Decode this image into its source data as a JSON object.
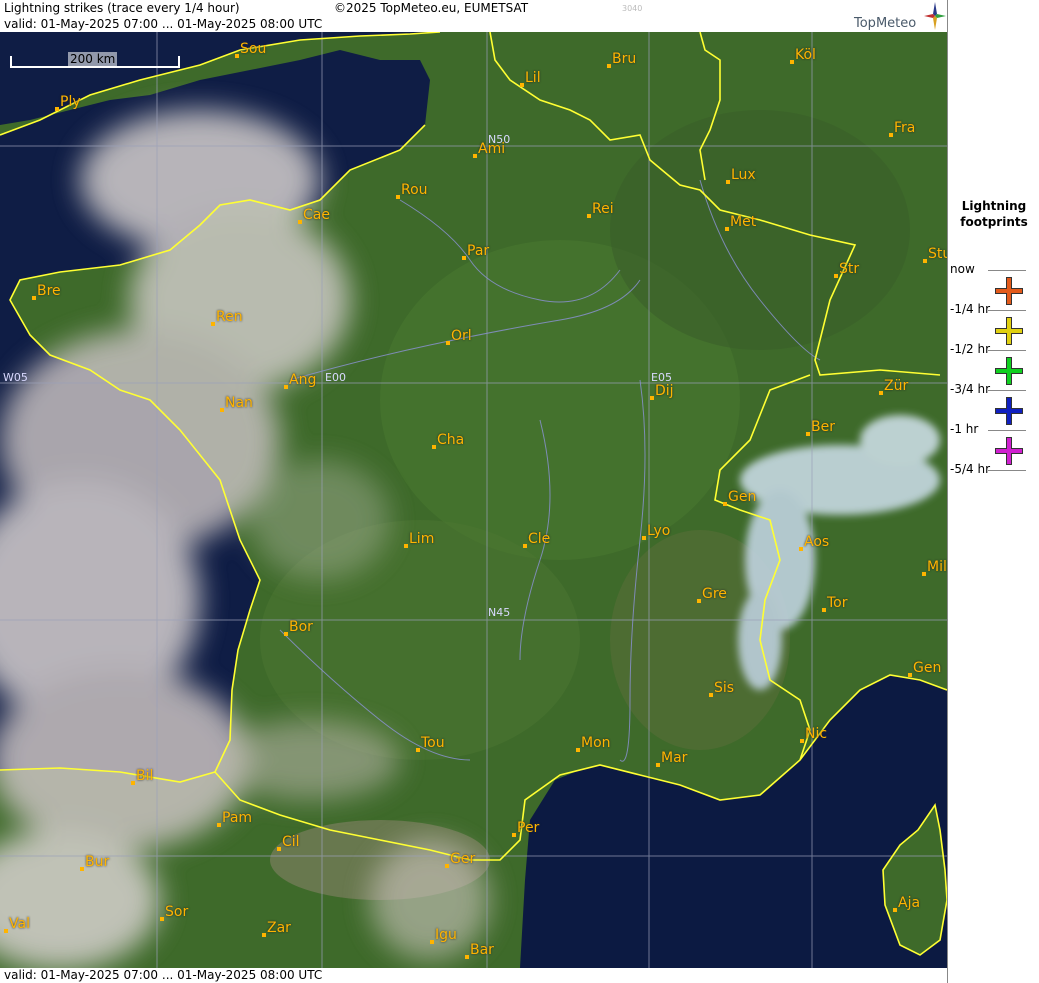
{
  "header": {
    "title": "Lightning strikes (trace every 1/4 hour)",
    "copyright": "©2025 TopMeteo.eu, EUMETSAT",
    "code": "3040",
    "valid": "valid:  01-May-2025 07:00 ... 01-May-2025 08:00 UTC",
    "brand": "TopMeteo"
  },
  "footer": {
    "valid": "valid:  01-May-2025 07:00 ... 01-May-2025 08:00 UTC"
  },
  "scale_label": "200 km",
  "grid_labels": [
    "N50",
    "E00",
    "E05",
    "W05",
    "N45"
  ],
  "cities": [
    "Sou",
    "Ply",
    "Lil",
    "Bru",
    "Köl",
    "Ami",
    "Fra",
    "Rou",
    "Lux",
    "Cae",
    "Rei",
    "Met",
    "Par",
    "Stu",
    "Str",
    "Bre",
    "Ren",
    "Orl",
    "Ang",
    "Zür",
    "Dij",
    "Nan",
    "Ber",
    "Cha",
    "Gen",
    "Lim",
    "Cle",
    "Lyo",
    "Aos",
    "Mil",
    "Gre",
    "Bor",
    "Tor",
    "Gen",
    "Sis",
    "Tou",
    "Mon",
    "Mar",
    "Nic",
    "Bil",
    "Pam",
    "Per",
    "Cil",
    "Ger",
    "Bur",
    "Sor",
    "Aja",
    "Val",
    "Zar",
    "Igu",
    "Bar"
  ],
  "legend": {
    "title_line1": "Lightning",
    "title_line2": "footprints",
    "rows": [
      {
        "label": "now",
        "color": "#e35a1a"
      },
      {
        "label": "-1/4 hr",
        "color": "#e0d010"
      },
      {
        "label": "-1/2 hr",
        "color": "#10d020"
      },
      {
        "label": "-3/4 hr",
        "color": "#1020c0"
      },
      {
        "label": "-1 hr",
        "color": "#d020d0"
      },
      {
        "label": "-5/4 hr",
        "color": ""
      }
    ]
  },
  "colors": {
    "label": "#ffb400",
    "border": "#ffff33",
    "grid": "#9aa0b8",
    "sea": "#0f1d45",
    "land": "#3e6a2a"
  }
}
